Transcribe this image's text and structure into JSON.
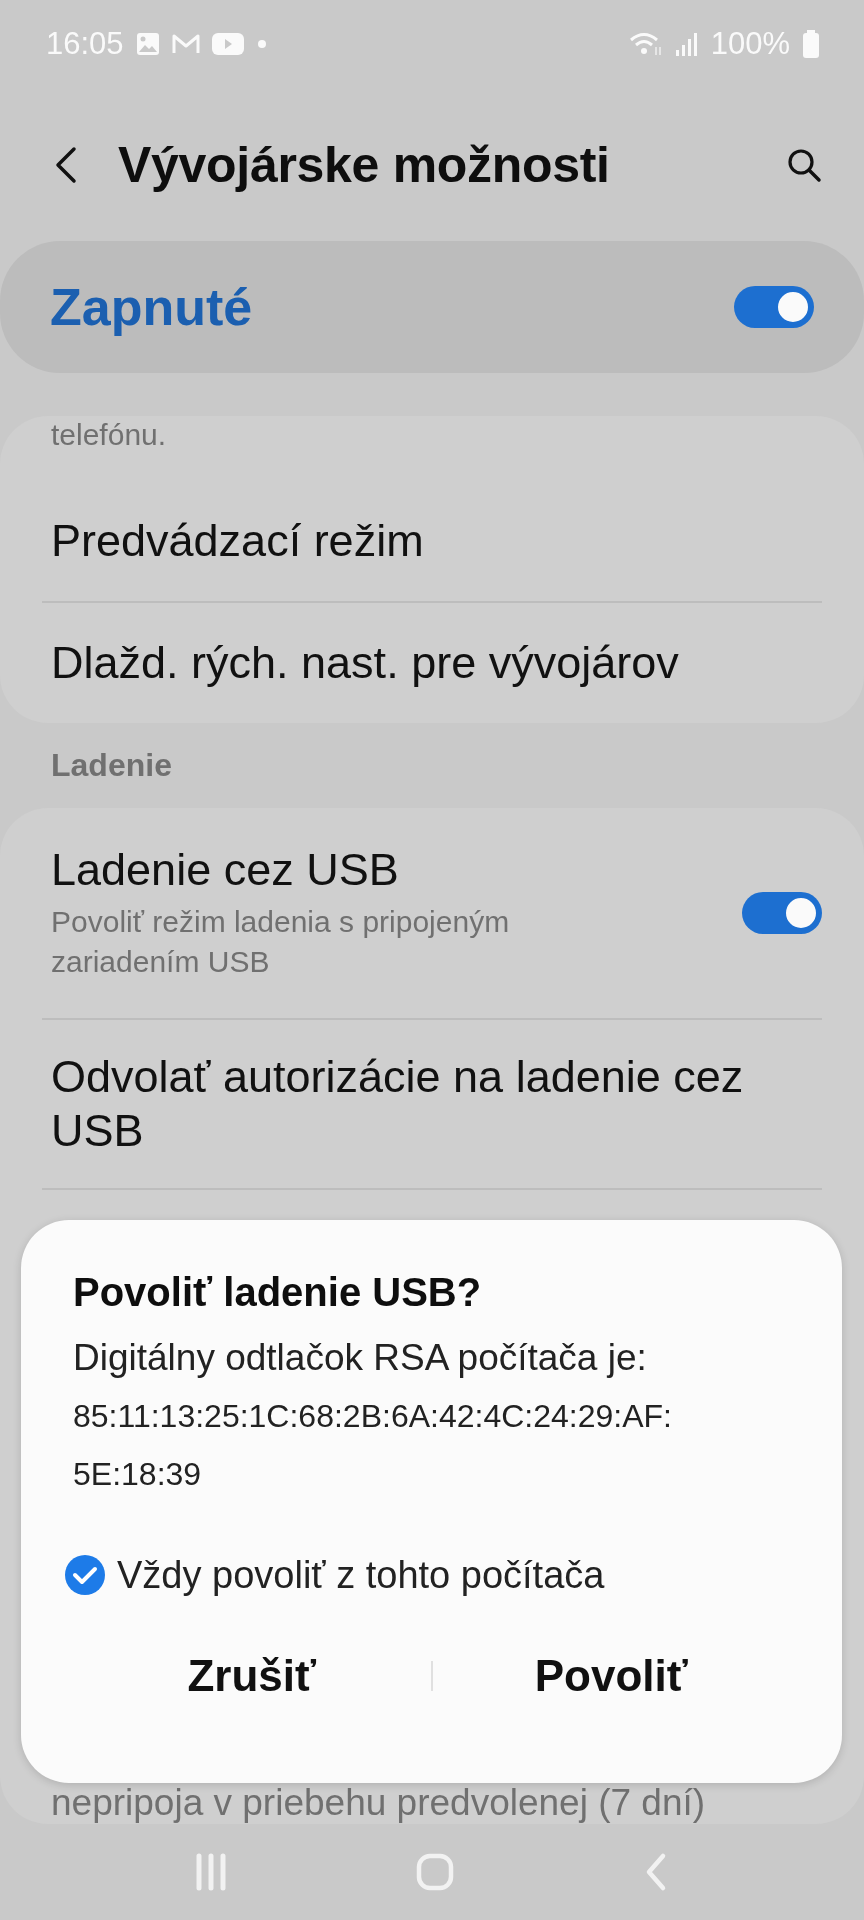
{
  "status_bar": {
    "time": "16:05",
    "battery": "100%"
  },
  "header": {
    "title": "Vývojárske možnosti"
  },
  "master_switch": {
    "label": "Zapnuté",
    "on": true
  },
  "groups": [
    {
      "items": [
        {
          "kind": "fragment",
          "title": "telefónu."
        },
        {
          "kind": "link",
          "title": "Predvádzací režim"
        },
        {
          "kind": "link",
          "title": "Dlažd. rých. nast. pre vývojárov"
        }
      ]
    },
    {
      "header": "Ladenie",
      "items": [
        {
          "kind": "switch",
          "title": "Ladenie cez USB",
          "subtitle": "Povoliť režim ladenia s pripojeným zariadením USB",
          "on": true
        },
        {
          "kind": "link",
          "title": "Odvolať autorizácie na ladenie cez USB"
        },
        {
          "kind": "tail",
          "title": "nepripoja v priebehu predvolenej (7 dní)"
        }
      ]
    }
  ],
  "dialog": {
    "title": "Povoliť ladenie USB?",
    "message": "Digitálny odtlačok RSA počítača je:",
    "fingerprint_lines": [
      "85:11:13:25:1C:68:2B:6A:42:4C:24:29:AF:",
      "5E:18:39"
    ],
    "checkbox": {
      "label": "Vždy povoliť z tohto počítača",
      "checked": true
    },
    "buttons": [
      "Zrušiť",
      "Povoliť"
    ]
  }
}
